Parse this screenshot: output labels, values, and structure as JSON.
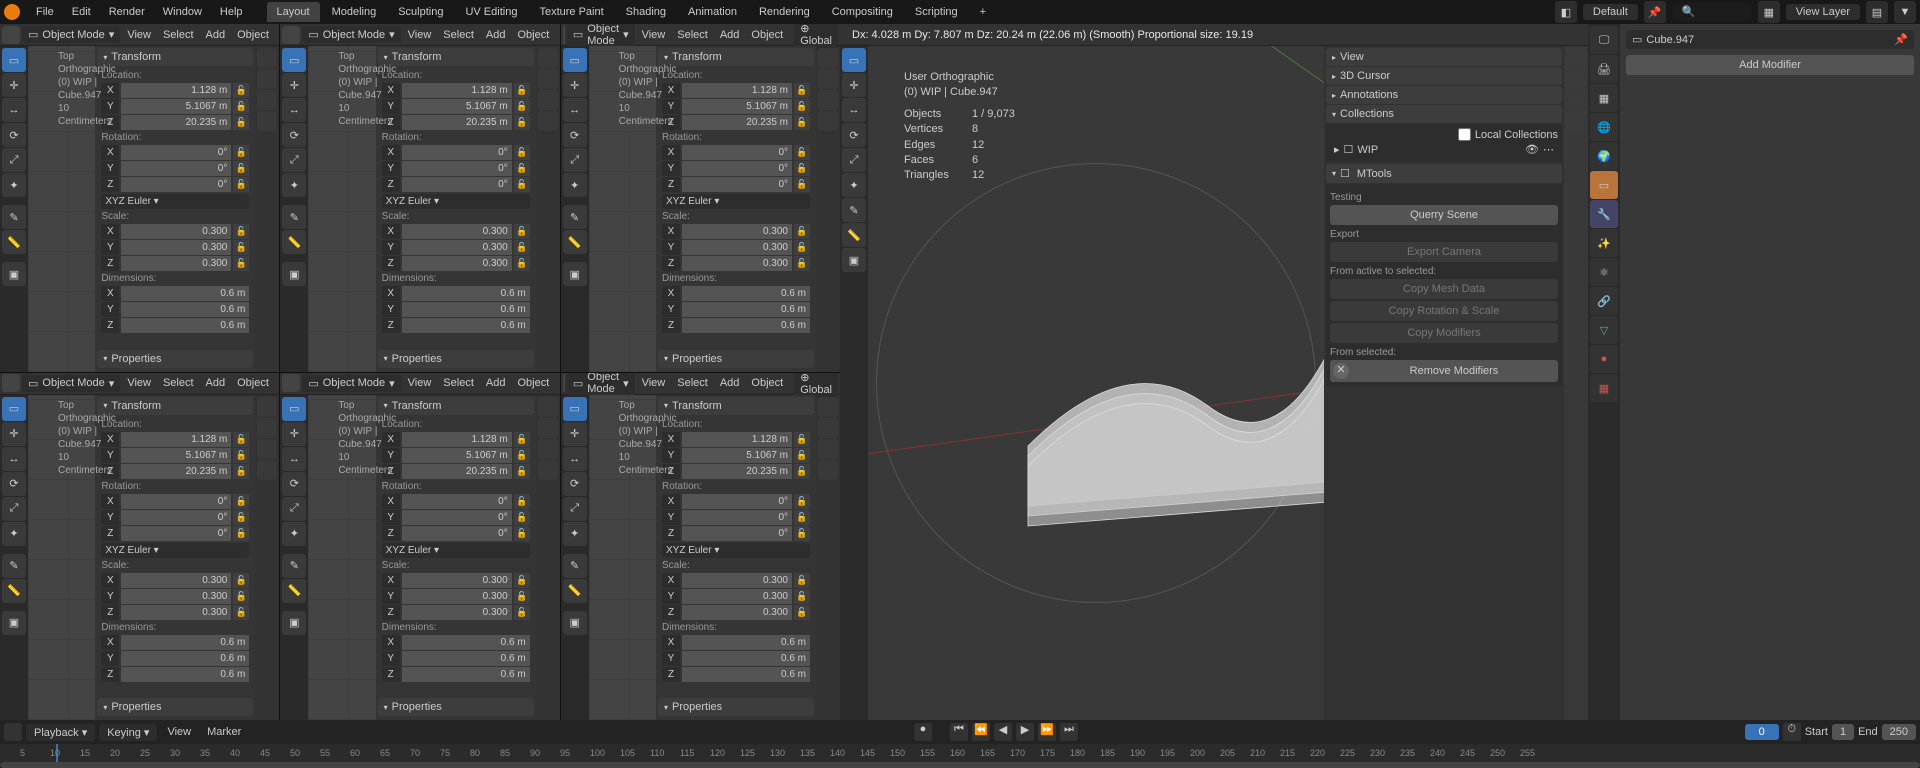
{
  "top_menu": {
    "items": [
      "File",
      "Edit",
      "Render",
      "Window",
      "Help"
    ],
    "tabs": [
      "Layout",
      "Modeling",
      "Sculpting",
      "UV Editing",
      "Texture Paint",
      "Shading",
      "Animation",
      "Rendering",
      "Compositing",
      "Scripting"
    ],
    "active_tab": 0,
    "scene": "Default",
    "viewlayer": "View Layer"
  },
  "viewport_header": {
    "mode": "Object Mode",
    "menus": [
      "View",
      "Select",
      "Add",
      "Object"
    ],
    "orientation": "Global"
  },
  "overlay": {
    "view": "Top Orthographic",
    "object": "(0) WIP | Cube.947",
    "grid": "10 Centimeters"
  },
  "transform": {
    "title": "Transform",
    "location_label": "Location:",
    "location": {
      "X": "1.128 m",
      "Y": "5.1067 m",
      "Z": "20.235 m"
    },
    "rotation_label": "Rotation:",
    "rotation": {
      "X": "0°",
      "Y": "0°",
      "Z": "0°"
    },
    "rotation_mode": "XYZ Euler",
    "scale_label": "Scale:",
    "scale": {
      "X": "0.300",
      "Y": "0.300",
      "Z": "0.300"
    },
    "dimensions_label": "Dimensions:",
    "dimensions": {
      "X": "0.6 m",
      "Y": "0.6 m",
      "Z": "0.6 m"
    },
    "properties": "Properties"
  },
  "big_view": {
    "status": "Dx: 4.028 m   Dy: 7.807 m   Dz: 20.24 m (22.06 m) (Smooth)   Proportional size: 19.19",
    "view": "User Orthographic",
    "object": "(0) WIP | Cube.947",
    "stats": {
      "Objects": "1 / 9,073",
      "Vertices": "8",
      "Edges": "12",
      "Faces": "6",
      "Triangles": "12"
    }
  },
  "right": {
    "sections": [
      "View",
      "3D Cursor",
      "Annotations",
      "Collections"
    ],
    "local_collections": "Local Collections",
    "wip": "WIP",
    "mtools": {
      "title": "MTools",
      "testing": "Testing",
      "query": "Querry Scene",
      "export": "Export",
      "export_camera": "Export Camera",
      "from_active": "From active to selected:",
      "copy_mesh": "Copy Mesh Data",
      "copy_rot": "Copy Rotation & Scale",
      "copy_mod": "Copy Modifiers",
      "from_selected": "From selected:",
      "remove": "Remove Modifiers"
    }
  },
  "props": {
    "object_name": "Cube.947",
    "add_modifier": "Add Modifier"
  },
  "timeline": {
    "playback": "Playback",
    "keying": "Keying",
    "view": "View",
    "marker": "Marker",
    "current": "0",
    "start_label": "Start",
    "start": "1",
    "end_label": "End",
    "end": "250",
    "frames": [
      "5",
      "10",
      "15",
      "20",
      "25",
      "30",
      "35",
      "40",
      "45",
      "50",
      "55",
      "60",
      "65",
      "70",
      "75",
      "80",
      "85",
      "90",
      "95",
      "100",
      "105",
      "110",
      "115",
      "120",
      "125",
      "130",
      "135",
      "140",
      "145",
      "150",
      "155",
      "160",
      "165",
      "170",
      "175",
      "180",
      "185",
      "190",
      "195",
      "200",
      "205",
      "210",
      "215",
      "220",
      "225",
      "230",
      "235",
      "240",
      "245",
      "250",
      "255"
    ]
  }
}
